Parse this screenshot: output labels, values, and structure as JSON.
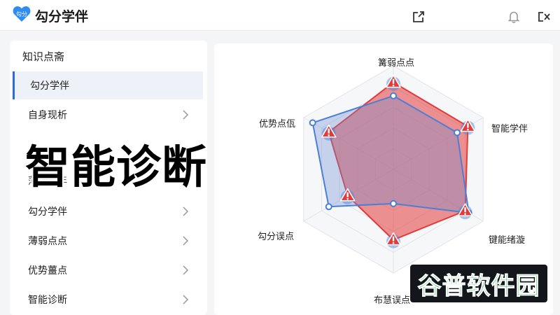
{
  "header": {
    "logo_text": "勾分",
    "app_title": "勾分学伴",
    "icons": [
      "share-icon",
      "bell-icon",
      "exit-icon"
    ]
  },
  "sidebar": {
    "title": "知识点斋",
    "items": [
      {
        "label": "勾分学伴",
        "active": true
      },
      {
        "label": "自身现析",
        "active": false
      },
      {
        "label": "薄势频年",
        "active": false
      },
      {
        "label": "勾分学伴",
        "active": false
      },
      {
        "label": "薄弱点点",
        "active": false
      },
      {
        "label": "优势薑点",
        "active": false
      },
      {
        "label": "智能诊断",
        "active": false
      }
    ]
  },
  "overlay": {
    "headline": "智能诊断"
  },
  "chart_data": {
    "type": "radar",
    "axes": [
      "篝弱点点",
      "智能学伴",
      "键能绪漩",
      "布慧误点",
      "勾分误点",
      "优势点佤"
    ],
    "series": [
      {
        "color": "#e23b3b",
        "values": [
          0.84,
          0.83,
          0.8,
          0.68,
          0.51,
          0.72
        ]
      },
      {
        "color": "#4a7fd6",
        "values": [
          0.71,
          0.71,
          0.84,
          0.33,
          0.72,
          0.9
        ]
      }
    ],
    "grid_levels": 5
  },
  "watermark": {
    "text": "谷普软件园"
  },
  "colors": {
    "accent": "#2f6bd6",
    "red": "#e23b3b",
    "blue": "#4a7fd6"
  }
}
